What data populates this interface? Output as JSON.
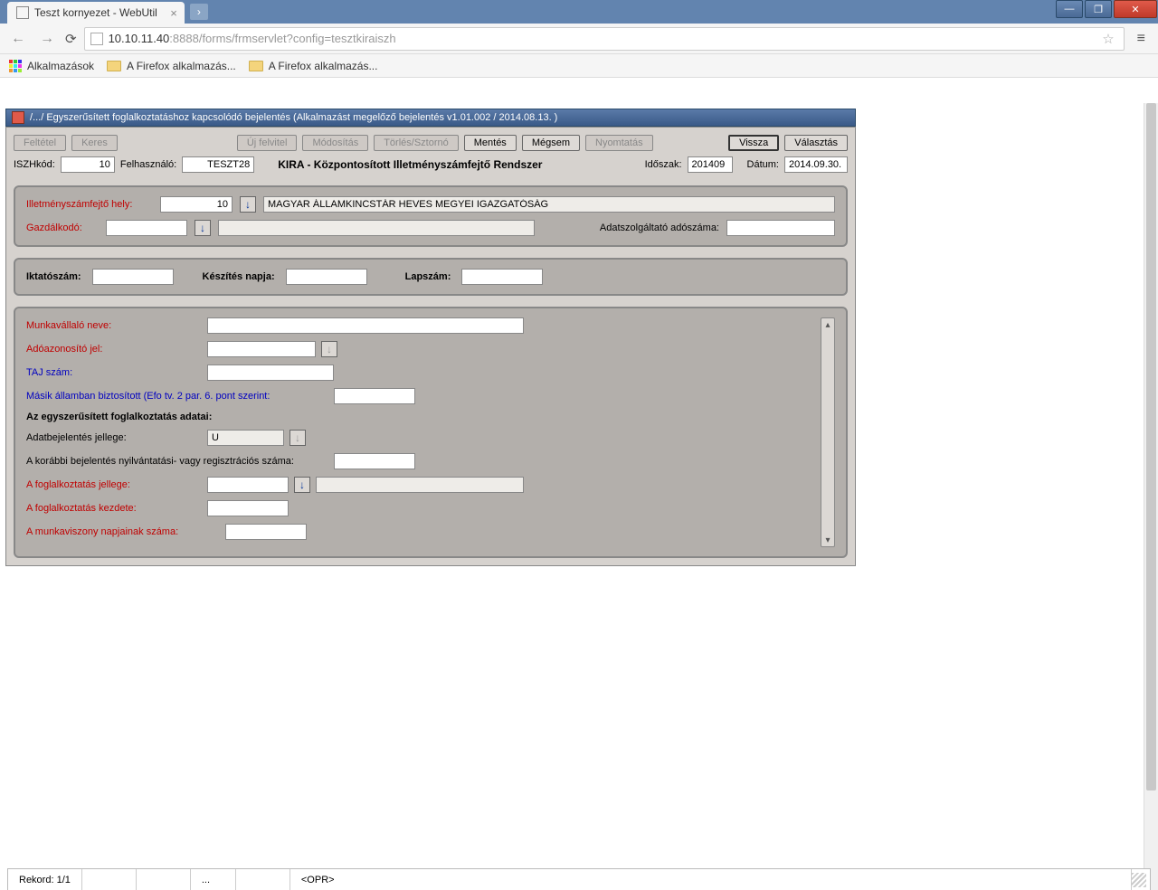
{
  "browser": {
    "tab_title": "Teszt kornyezet - WebUtil",
    "url_host": "10.10.11.40",
    "url_rest": ":8888/forms/frmservlet?config=tesztkiraiszh",
    "bookmarks": {
      "apps": "Alkalmazások",
      "ff1": "A Firefox alkalmazás...",
      "ff2": "A Firefox alkalmazás..."
    }
  },
  "applet": {
    "title": "/.../ Egyszerűsített foglalkoztatáshoz kapcsolódó bejelentés (Alkalmazást megelőző bejelentés v1.01.002 / 2014.08.13. )",
    "toolbar": {
      "feltetel": "Feltétel",
      "keres": "Keres",
      "uj_felvitel": "Új felvitel",
      "modositas": "Módosítás",
      "torles": "Törlés/Sztornó",
      "mentes": "Mentés",
      "megsem": "Mégsem",
      "nyomtatas": "Nyomtatás",
      "vissza": "Vissza",
      "valasztas": "Választás"
    },
    "header": {
      "iszh_label": "ISZHkód:",
      "iszh_value": "10",
      "felhasznalo_label": "Felhasználó:",
      "felhasznalo_value": "TESZT28",
      "system_title": "KIRA - Központosított Illetményszámfejtő Rendszer",
      "idoszak_label": "Időszak:",
      "idoszak_value": "201409",
      "datum_label": "Dátum:",
      "datum_value": "2014.09.30."
    },
    "panel1": {
      "illet_label": "Illetményszámfejtő hely:",
      "illet_code": "10",
      "illet_name": "MAGYAR ÁLLAMKINCSTÁR HEVES MEGYEI IGAZGATÓSÁG",
      "gazd_label": "Gazdálkodó:",
      "gazd_code": "",
      "gazd_name": "",
      "adoszam_label": "Adatszolgáltató adószáma:",
      "adoszam_value": ""
    },
    "panel2": {
      "iktato_label": "Iktatószám:",
      "iktato_value": "",
      "keszites_label": "Készítés napja:",
      "keszites_value": "",
      "lapszam_label": "Lapszám:",
      "lapszam_value": ""
    },
    "main": {
      "munkavallalo_label": "Munkavállaló neve:",
      "munkavallalo_value": "",
      "adoazon_label": "Adóazonosító jel:",
      "adoazon_value": "",
      "taj_label": "TAJ szám:",
      "taj_value": "",
      "masik_label": "Másik államban biztosított (Efo tv. 2 par. 6. pont szerint:",
      "masik_value": "",
      "section_header": "Az egyszerűsített foglalkoztatás adatai:",
      "adatbej_label": "Adatbejelentés jellege:",
      "adatbej_value": "U",
      "korabbi_label": "A korábbi bejelentés nyilvántatási- vagy regisztrációs száma:",
      "korabbi_value": "",
      "foglj_label": "A foglalkoztatás jellege:",
      "foglj_code": "",
      "foglj_name": "",
      "foglk_label": "A foglalkoztatás kezdete:",
      "foglk_value": "",
      "napjai_label": "A munkaviszony napjainak száma:",
      "napjai_value": ""
    }
  },
  "statusbar": {
    "record": "Rekord: 1/1",
    "dots": "...",
    "opr": "<OPR>"
  }
}
